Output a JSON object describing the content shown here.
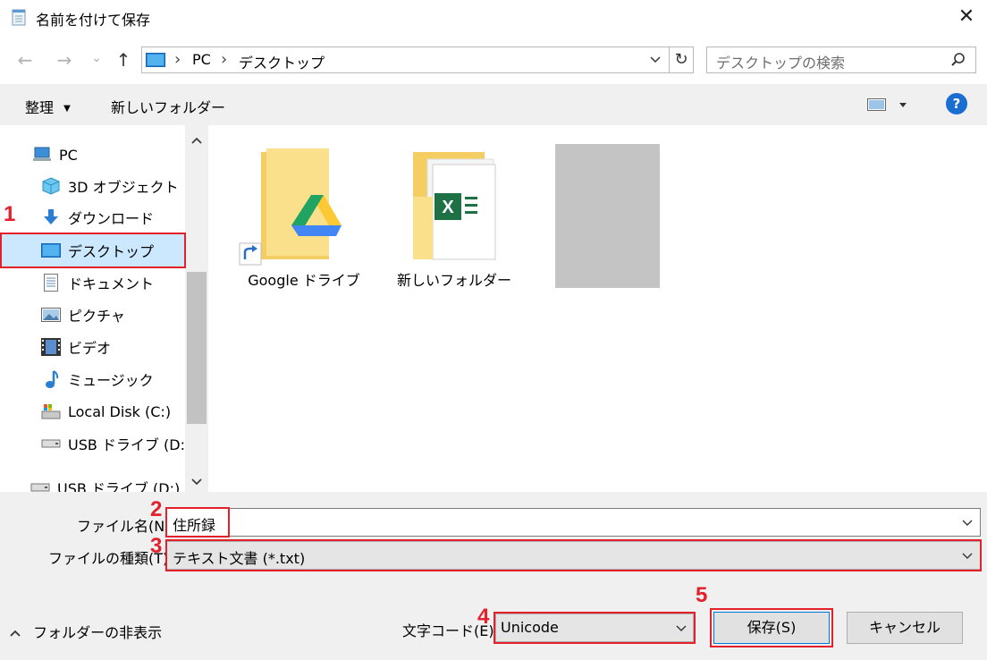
{
  "window": {
    "title": "名前を付けて保存",
    "close_glyph": "✕"
  },
  "nav": {
    "back": "←",
    "forward": "→",
    "recent": "⌄",
    "up": "↑",
    "breadcrumb": [
      "PC",
      "デスクトップ"
    ],
    "breadcrumb_sep": "›",
    "refresh": "↻",
    "search_placeholder": "デスクトップの検索"
  },
  "toolbar": {
    "organize": "整理",
    "new_folder": "新しいフォルダー",
    "help": "?"
  },
  "sidebar": {
    "items": [
      {
        "label": "PC",
        "icon": "pc-icon"
      },
      {
        "label": "3D オブジェクト",
        "icon": "3d-objects-icon"
      },
      {
        "label": "ダウンロード",
        "icon": "download-icon"
      },
      {
        "label": "デスクトップ",
        "icon": "desktop-icon",
        "selected": true
      },
      {
        "label": "ドキュメント",
        "icon": "document-icon"
      },
      {
        "label": "ピクチャ",
        "icon": "pictures-icon"
      },
      {
        "label": "ビデオ",
        "icon": "video-icon"
      },
      {
        "label": "ミュージック",
        "icon": "music-icon"
      },
      {
        "label": "Local Disk (C:)",
        "icon": "local-disk-icon"
      },
      {
        "label": "USB ドライブ (D:)",
        "icon": "usb-drive-icon"
      },
      {
        "label": "USB ドライブ (D:)",
        "icon": "usb-drive-icon"
      }
    ]
  },
  "files": [
    {
      "name": "Google ドライブ",
      "icon": "google-drive-folder-icon"
    },
    {
      "name": "新しいフォルダー",
      "icon": "excel-folder-icon"
    },
    {
      "name": "",
      "icon": "blank-thumbnail"
    }
  ],
  "form": {
    "filename_label": "ファイル名(N):",
    "filename_value": "住所録",
    "filetype_label": "ファイルの種類(T):",
    "filetype_value": "テキスト文書 (*.txt)",
    "encoding_label": "文字コード(E):",
    "encoding_value": "Unicode",
    "hide_folders": "フォルダーの非表示",
    "save": "保存(S)",
    "cancel": "キャンセル"
  },
  "annotations": [
    "1",
    "2",
    "3",
    "4",
    "5"
  ],
  "colors": {
    "annotation": "#e4202b",
    "selection": "#cce8ff",
    "help": "#1a6dd1"
  }
}
